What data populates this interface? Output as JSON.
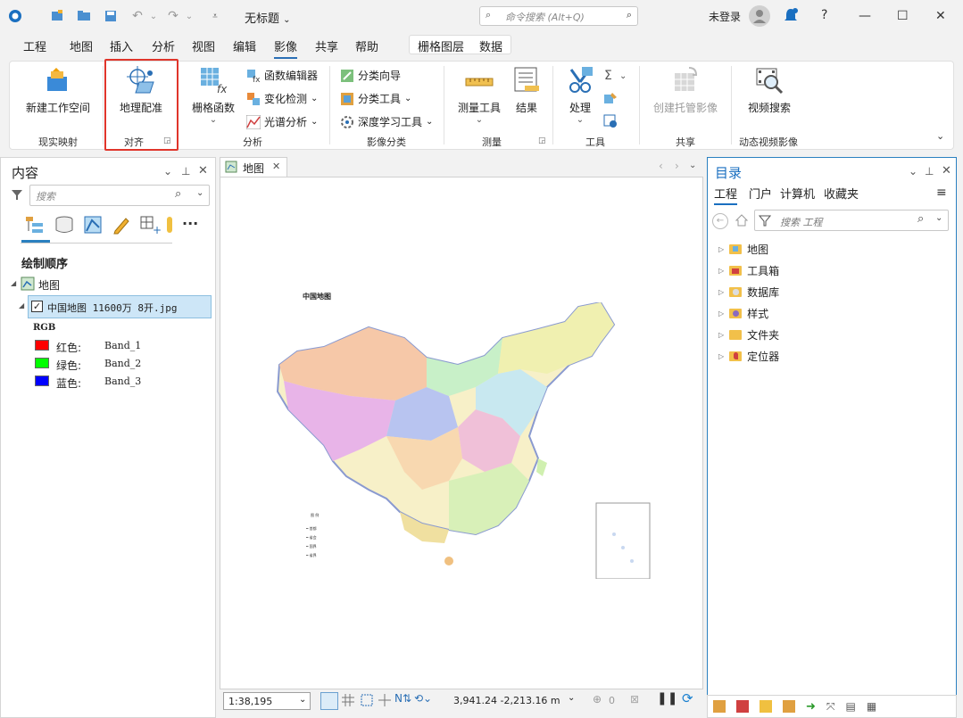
{
  "titlebar": {
    "app_title": "无标题",
    "search_placeholder": "命令搜索 (Alt+Q)",
    "user": "未登录",
    "help": "?"
  },
  "menu": {
    "tabs": [
      "工程",
      "地图",
      "插入",
      "分析",
      "视图",
      "编辑",
      "影像",
      "共享",
      "帮助"
    ],
    "active": "影像",
    "context_tabs": [
      "栅格图层",
      "数据"
    ]
  },
  "ribbon": {
    "new_workspace": "新建工作空间",
    "group_ortho": "现实映射",
    "georef": "地理配准",
    "group_align": "对齐",
    "raster_functions": "栅格函数",
    "function_editor": "函数编辑器",
    "change_detection": "变化检测",
    "spectral_analysis": "光谱分析",
    "group_analysis": "分析",
    "classify_wizard": "分类向导",
    "classify_tools": "分类工具",
    "deep_learning": "深度学习工具",
    "group_classification": "影像分类",
    "measure_tools": "测量工具",
    "results": "结果",
    "group_measure": "测量",
    "process": "处理",
    "group_tools": "工具",
    "create_hosted": "创建托管影像",
    "group_share": "共享",
    "video_search": "视频搜索",
    "group_motion": "动态视频影像"
  },
  "contents": {
    "title": "内容",
    "search_placeholder": "搜索",
    "drawing_order": "绘制顺序",
    "map_name": "地图",
    "layer_name": "中国地图 11600万 8开.jpg",
    "rgb_label": "RGB",
    "bands": [
      {
        "label": "红色:",
        "band": "Band_1",
        "color": "#ff0000"
      },
      {
        "label": "绿色:",
        "band": "Band_2",
        "color": "#00ff00"
      },
      {
        "label": "蓝色:",
        "band": "Band_3",
        "color": "#0000ff"
      }
    ]
  },
  "mapview": {
    "tab_label": "地图",
    "map_caption": "中国地图",
    "scale": "1:38,195",
    "coords": "3,941.24 -2,213.16 m",
    "selected_count": "0"
  },
  "catalog": {
    "title": "目录",
    "tabs": [
      "工程",
      "门户",
      "计算机",
      "收藏夹"
    ],
    "search_placeholder": "搜索 工程",
    "items": [
      "地图",
      "工具箱",
      "数据库",
      "样式",
      "文件夹",
      "定位器"
    ]
  }
}
